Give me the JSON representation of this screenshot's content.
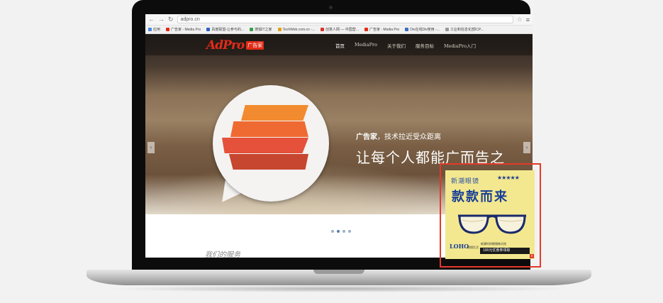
{
  "browser": {
    "url": "adpro.cn",
    "bookmarks": [
      {
        "label": "应用",
        "color": "#4a89dc"
      },
      {
        "label": "广告家 - Media Pro",
        "color": "#e22b18"
      },
      {
        "label": "百度联盟-让参与的...",
        "color": "#2f5fbf"
      },
      {
        "label": "搜狐IT之家",
        "color": "#35a04b"
      },
      {
        "label": "TechWeb.com.cn -...",
        "color": "#e0a21b"
      },
      {
        "label": "创意人网 — 中国营...",
        "color": "#d9342b"
      },
      {
        "label": "广告家 - Media Pro",
        "color": "#e22b18"
      },
      {
        "label": "Div在线Div使用 -...",
        "color": "#3b6fc2"
      },
      {
        "label": "工业和信息化部ICP...",
        "color": "#999999"
      }
    ]
  },
  "site": {
    "logo_text": "AdPro",
    "logo_badge": "广告家",
    "nav": [
      "首页",
      "MediaPro",
      "关于我们",
      "服务目标",
      "MediaPro入门"
    ],
    "hero": {
      "tagline_brand": "广告家",
      "tagline_rest": "，技术拉近受众距离",
      "slogan": "让每个人都能广而告之"
    },
    "arrow_left": "‹",
    "arrow_right": "›",
    "carousel_active_dot": 1,
    "services_heading": "我们的服务"
  },
  "ad": {
    "subtitle": "新潮眼镜",
    "stars": "★★★★★",
    "title": "款款而来",
    "brand": "LOHO",
    "brand_sub": "眼镜生活",
    "promo": "新潮时尚眼镜每天抢",
    "coupon": "100元优惠券领取",
    "close": "x",
    "highlight_color": "#e23a2a"
  }
}
